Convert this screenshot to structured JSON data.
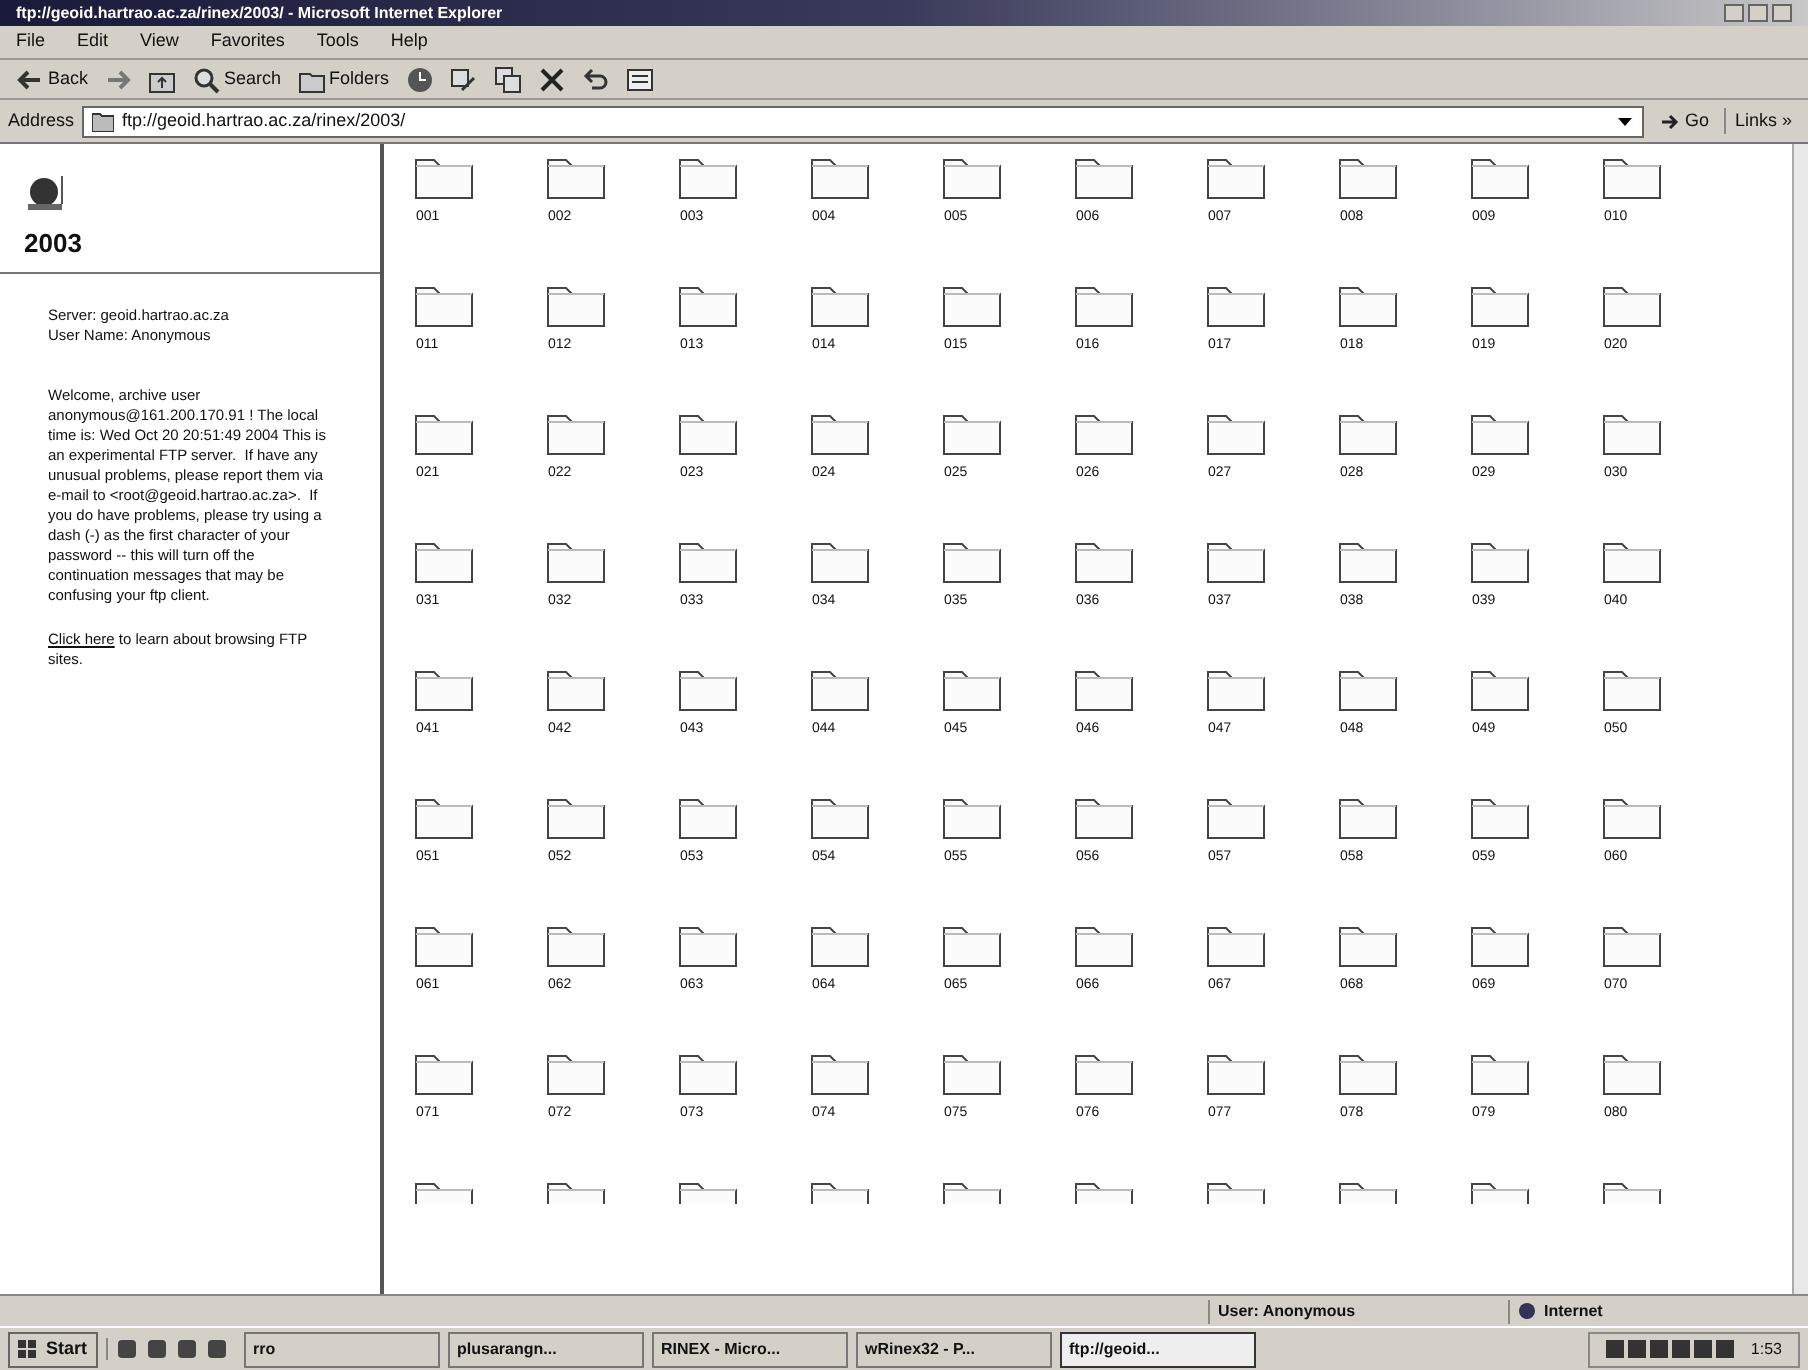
{
  "window": {
    "title": "ftp://geoid.hartrao.ac.za/rinex/2003/ - Microsoft Internet Explorer"
  },
  "menu": [
    "File",
    "Edit",
    "View",
    "Favorites",
    "Tools",
    "Help"
  ],
  "toolbar": [
    {
      "kind": "back",
      "label": "Back"
    },
    {
      "kind": "forward"
    },
    {
      "kind": "up"
    },
    {
      "kind": "search",
      "label": "Search"
    },
    {
      "kind": "folders",
      "label": "Folders"
    },
    {
      "kind": "history"
    },
    {
      "kind": "move"
    },
    {
      "kind": "copy"
    },
    {
      "kind": "delete"
    },
    {
      "kind": "undo"
    },
    {
      "kind": "views"
    }
  ],
  "address": {
    "label": "Address",
    "value": "ftp://geoid.hartrao.ac.za/rinex/2003/",
    "go": "Go",
    "links": "Links »"
  },
  "panel": {
    "title": "2003",
    "server": "Server: geoid.hartrao.ac.za",
    "user": "User Name: Anonymous",
    "welcome": "Welcome, archive user anonymous@161.200.170.91 ! The local time is: Wed Oct 20 20:51:49 2004 This is an experimental FTP server.  If have any unusual problems, please report them via e-mail to <root@geoid.hartrao.ac.za>.  If you do have problems, please try using a dash (-) as the first character of your password -- this will turn off the continuation messages that may be confusing your ftp client.",
    "link": "Click here",
    "link_rest": " to learn about browsing FTP sites."
  },
  "folders": [
    {
      "label": "001"
    },
    {
      "label": "002"
    },
    {
      "label": "003"
    },
    {
      "label": "004"
    },
    {
      "label": "005"
    },
    {
      "label": "006"
    },
    {
      "label": "007"
    },
    {
      "label": "008"
    },
    {
      "label": "009"
    },
    {
      "label": "010"
    },
    {
      "label": "011"
    },
    {
      "label": "012"
    },
    {
      "label": "013"
    },
    {
      "label": "014"
    },
    {
      "label": "015"
    },
    {
      "label": "016"
    },
    {
      "label": "017"
    },
    {
      "label": "018"
    },
    {
      "label": "019"
    },
    {
      "label": "020"
    },
    {
      "label": "021"
    },
    {
      "label": "022"
    },
    {
      "label": "023"
    },
    {
      "label": "024"
    },
    {
      "label": "025"
    },
    {
      "label": "026"
    },
    {
      "label": "027"
    },
    {
      "label": "028"
    },
    {
      "label": "029"
    },
    {
      "label": "030"
    },
    {
      "label": "031"
    },
    {
      "label": "032"
    },
    {
      "label": "033"
    },
    {
      "label": "034"
    },
    {
      "label": "035"
    },
    {
      "label": "036"
    },
    {
      "label": "037"
    },
    {
      "label": "038"
    },
    {
      "label": "039"
    },
    {
      "label": "040"
    },
    {
      "label": "041"
    },
    {
      "label": "042"
    },
    {
      "label": "043"
    },
    {
      "label": "044"
    },
    {
      "label": "045"
    },
    {
      "label": "046"
    },
    {
      "label": "047"
    },
    {
      "label": "048"
    },
    {
      "label": "049"
    },
    {
      "label": "050"
    },
    {
      "label": "051"
    },
    {
      "label": "052"
    },
    {
      "label": "053"
    },
    {
      "label": "054"
    },
    {
      "label": "055"
    },
    {
      "label": "056"
    },
    {
      "label": "057"
    },
    {
      "label": "058"
    },
    {
      "label": "059"
    },
    {
      "label": "060"
    },
    {
      "label": "061"
    },
    {
      "label": "062"
    },
    {
      "label": "063"
    },
    {
      "label": "064"
    },
    {
      "label": "065"
    },
    {
      "label": "066"
    },
    {
      "label": "067"
    },
    {
      "label": "068"
    },
    {
      "label": "069"
    },
    {
      "label": "070"
    },
    {
      "label": "071"
    },
    {
      "label": "072"
    },
    {
      "label": "073"
    },
    {
      "label": "074"
    },
    {
      "label": "075"
    },
    {
      "label": "076"
    },
    {
      "label": "077"
    },
    {
      "label": "078"
    },
    {
      "label": "079"
    },
    {
      "label": "080"
    }
  ],
  "partial_row": [
    {
      "kind": "folder"
    },
    {
      "kind": "folder"
    },
    {
      "kind": "folder"
    },
    {
      "kind": "folder"
    },
    {
      "kind": "folder"
    },
    {
      "kind": "folder"
    },
    {
      "kind": "folder"
    },
    {
      "kind": "folder"
    },
    {
      "kind": "folder"
    },
    {
      "kind": "folder"
    }
  ],
  "status": {
    "user": "User: Anonymous",
    "zone": "Internet"
  },
  "taskbar": {
    "start": "Start",
    "tasks": [
      {
        "label": "rro",
        "selected": false
      },
      {
        "label": "plusarangn...",
        "selected": false
      },
      {
        "label": "RINEX - Micro...",
        "selected": false
      },
      {
        "label": "wRinex32 - P...",
        "selected": false
      },
      {
        "label": "ftp://geoid...",
        "selected": true
      }
    ],
    "clock": "1:53"
  }
}
